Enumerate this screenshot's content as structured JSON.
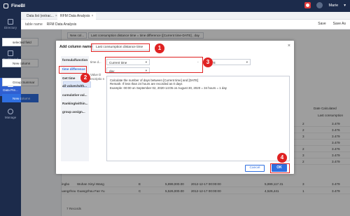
{
  "app": {
    "title": "FineBI",
    "user": "Marie"
  },
  "sidebar": [
    {
      "label": "Directory",
      "icon": "directory-icon"
    },
    {
      "label": "Dashboard",
      "icon": "dashboard-icon"
    },
    {
      "label": "Data Pre...",
      "icon": "data-prep-icon"
    },
    {
      "label": "Manage",
      "icon": "manage-icon"
    }
  ],
  "tabs": [
    {
      "label": "Data list (extrac..."
    },
    {
      "label": "RFM Data Analysis"
    }
  ],
  "header": {
    "table_name_label": "table name",
    "table_name_value": "RFM Data Analysis",
    "save": "Save",
    "save_as": "Save As"
  },
  "left_panel": {
    "selected_field": "selected field",
    "new_column": "New column",
    "group_summary": "Group Summar",
    "new_column_2": "New column"
  },
  "top_fields": {
    "new_col": "New col...",
    "formula": "Last consumption distance time = time difference ([Current time-DATE] , day"
  },
  "dialog": {
    "title": "Add column name",
    "column_name": "Last consumption distance time",
    "close": "×",
    "functions": [
      "formula/function",
      "time difference",
      "Get time",
      "all values/with...",
      "cumulative val...",
      "Ranking/within...",
      "group assign..."
    ],
    "param_time": "time d...",
    "param_desc": "Value D escriptio n",
    "field1": "Current time",
    "field2": "DATE",
    "unit": "day",
    "dash": "-",
    "description": [
      "Calculate the number of days between [Current time] and [DATE]",
      "Remark: If less than 24 hours are recorded as 0 days",
      "Example: 00:00 on September 02, 2020-14:05 on August 30, 2020 = 34 hours = 1 day"
    ],
    "cancel": "Cancel",
    "ok": "OK"
  },
  "table": {
    "headers": [
      "Date Calculated",
      "Last consumption"
    ],
    "rows": [
      {
        "c1": "2",
        "c2": "3.479"
      },
      {
        "c1": "2",
        "c2": "3.476"
      },
      {
        "c1": "3",
        "c2": "3.479"
      },
      {
        "c1": "",
        "c2": "3.479"
      },
      {
        "c1": "2",
        "c2": "3.476"
      },
      {
        "c1": "3",
        "c2": "3.479"
      },
      {
        "c1": "2",
        "c2": "3.479"
      }
    ],
    "bottom_rows": [
      {
        "a": "ingbo",
        "b": "Wuhan Xinyi Wang",
        "c": "E",
        "d": "5,899,000.00",
        "e": "2012-12-17 00:00:00",
        "f": "5,899,117.31",
        "g": "3",
        "h": "3.479"
      },
      {
        "a": "uangzhou",
        "b": "Guangzhou Fan Yu",
        "c": "C",
        "d": "5,526,000.00",
        "e": "2012-12-17 00:00:00",
        "f": "4,526,441",
        "g": "1",
        "h": "3.479"
      }
    ],
    "records": "Records"
  },
  "callouts": [
    "1",
    "2",
    "3",
    "4"
  ],
  "colors": {
    "accent": "#2f6fe0",
    "highlight": "#e02222",
    "nav": "#1c2b4b"
  }
}
